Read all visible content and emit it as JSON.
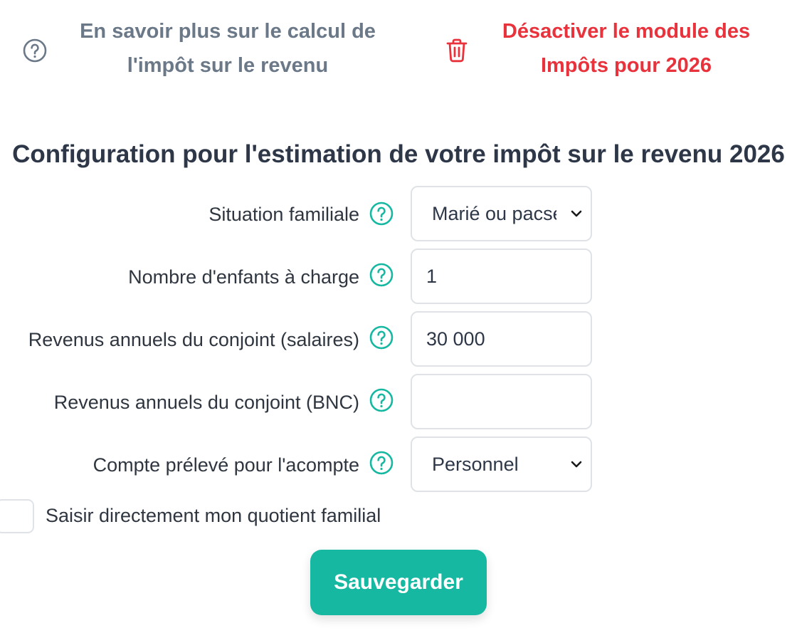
{
  "links": {
    "learn_more": {
      "line1": "En savoir plus sur le calcul de",
      "line2": "l'impôt sur le revenu"
    },
    "disable_module": {
      "line1": "Désactiver le module des",
      "line2": "Impôts pour 2026"
    }
  },
  "title": "Configuration pour l'estimation de votre impôt sur le revenu 2026",
  "form": {
    "situation": {
      "label": "Situation familiale",
      "value": "Marié ou pacsé"
    },
    "children": {
      "label": "Nombre d'enfants à charge",
      "value": "1"
    },
    "spouse_salary": {
      "label": "Revenus annuels du conjoint (salaires)",
      "value": "30 000"
    },
    "spouse_bnc": {
      "label": "Revenus annuels du conjoint (BNC)",
      "value": ""
    },
    "account": {
      "label": "Compte prélevé pour l'acompte",
      "value": "Personnel"
    },
    "quotient_checkbox": {
      "label": "Saisir directement mon quotient familial",
      "checked": false
    }
  },
  "save_label": "Sauvegarder",
  "colors": {
    "accent": "#16b8a2",
    "danger": "#e8323c",
    "muted_link": "#6b7888",
    "text": "#2d3748"
  }
}
